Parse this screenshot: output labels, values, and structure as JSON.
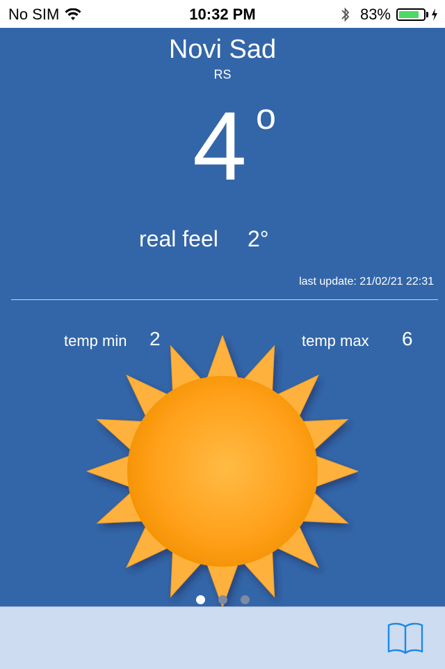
{
  "status_bar": {
    "carrier": "No SIM",
    "time": "10:32 PM",
    "battery_percent_label": "83%",
    "battery_level": 0.83,
    "icons": [
      "wifi-icon",
      "bluetooth-icon",
      "battery-icon",
      "charging-bolt-icon"
    ]
  },
  "weather": {
    "city": "Novi Sad",
    "country": "RS",
    "temperature": "4",
    "degree_symbol": "o",
    "real_feel_label": "real feel",
    "real_feel_value": "2°",
    "last_update": "last update: 21/02/21  22:31",
    "temp_min_label": "temp min",
    "temp_min_value": "2",
    "temp_max_label": "temp max",
    "temp_max_value": "6",
    "condition_icon": "sun-icon"
  },
  "pager": {
    "page_count": 3,
    "current_page": 1
  },
  "tab_bar": {
    "icon": "book-icon"
  },
  "colors": {
    "background": "#3366a8",
    "tab_bar": "#cddcf1",
    "sun_core": "#ff9e0f",
    "sun_rays": "#ffb13d",
    "accent_blue": "#1e88e5",
    "battery_green": "#4cd964"
  }
}
